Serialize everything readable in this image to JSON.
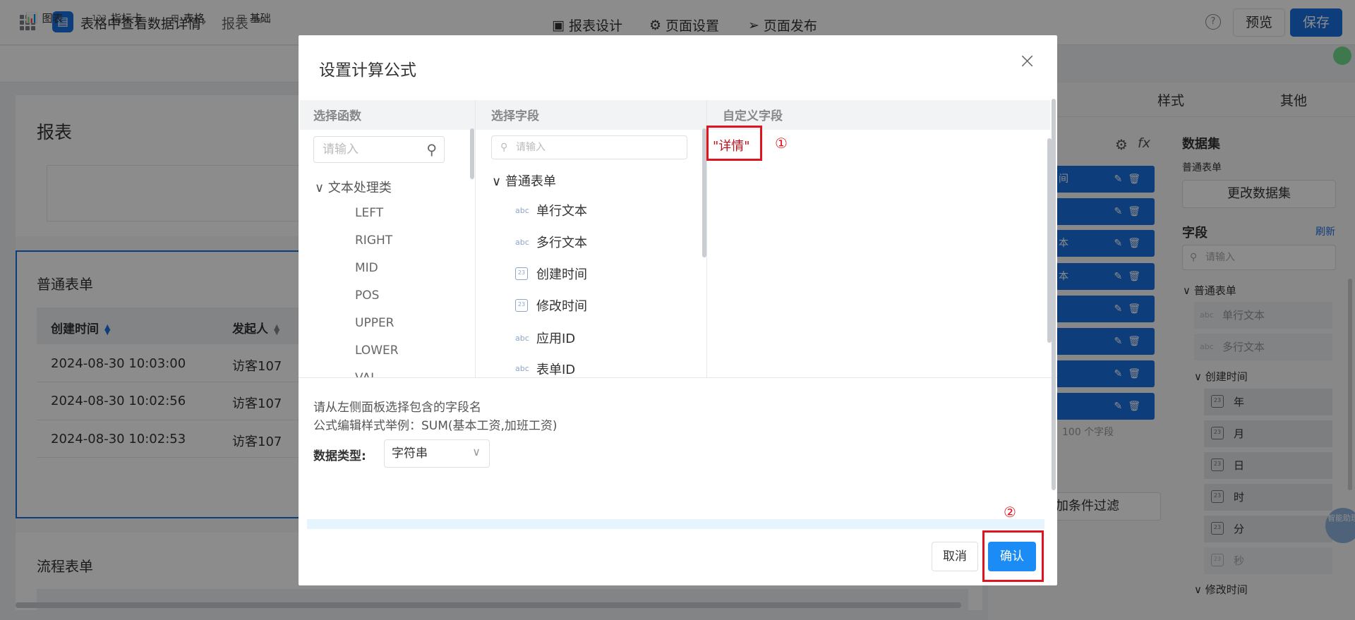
{
  "header": {
    "app_title": "表格中查看数据详情",
    "breadcrumb_sep": "›",
    "current_page": "报表",
    "nav": [
      "报表设计",
      "页面设置",
      "页面发布"
    ],
    "help": "?",
    "preview": "预览",
    "save": "保存"
  },
  "toolbar": {
    "items": [
      {
        "icon": "📊",
        "label": "图表"
      },
      {
        "icon": "123",
        "label": "指标卡"
      },
      {
        "icon": "⊞",
        "label": "表格"
      },
      {
        "icon": "⊟",
        "label": "基础"
      }
    ]
  },
  "canvas": {
    "report_title": "报表",
    "table_title": "普通表单",
    "columns": [
      "创建时间",
      "发起人"
    ],
    "rows": [
      [
        "2024-08-30 10:03:00",
        "访客107"
      ],
      [
        "2024-08-30 10:02:56",
        "访客107"
      ],
      [
        "2024-08-30 10:02:53",
        "访客107"
      ]
    ],
    "flow_title": "流程表单"
  },
  "right_panel": {
    "tabs": [
      "样式",
      "其他"
    ],
    "blue_items": [
      "间",
      "",
      "本",
      "本",
      "",
      "",
      "",
      ""
    ],
    "count_text": "100 个字段",
    "filter_label": "加条件过滤",
    "dataset_title": "数据集",
    "dataset_name": "普通表单",
    "change_dataset": "更改数据集",
    "field_title": "字段",
    "refresh": "刷新",
    "field_search_placeholder": "请输入",
    "tree_root": "普通表单",
    "leaves": [
      "单行文本",
      "多行文本"
    ],
    "leaf_prefix": "abc",
    "created_group": "创建时间",
    "date_parts": [
      "年",
      "月",
      "日",
      "时",
      "分",
      "秒"
    ],
    "modified_group": "修改时间",
    "badge_text": "智能助理"
  },
  "modal": {
    "title": "设置计算公式",
    "close": "×",
    "col_functions": "选择函数",
    "col_fields": "选择字段",
    "col_custom": "自定义字段",
    "fn_search_placeholder": "请输入",
    "fn_category": "文本处理类",
    "functions": [
      "LEFT",
      "RIGHT",
      "MID",
      "POS",
      "UPPER",
      "LOWER",
      "VAL"
    ],
    "fd_search_placeholder": "请输入",
    "fd_category": "普通表单",
    "fields": [
      {
        "type": "abc",
        "label": "单行文本"
      },
      {
        "type": "abc",
        "label": "多行文本"
      },
      {
        "type": "cal",
        "label": "创建时间"
      },
      {
        "type": "cal",
        "label": "修改时间"
      },
      {
        "type": "abc",
        "label": "应用ID"
      },
      {
        "type": "abc",
        "label": "表单ID"
      }
    ],
    "formula": "\"详情\"",
    "marker1": "①",
    "marker2": "②",
    "hint1": "请从左侧面板选择包含的字段名",
    "hint2": "公式编辑样式举例：SUM(基本工资,加班工资)",
    "dtype_label": "数据类型:",
    "dtype_value": "字符串",
    "cancel": "取消",
    "confirm": "确认"
  }
}
